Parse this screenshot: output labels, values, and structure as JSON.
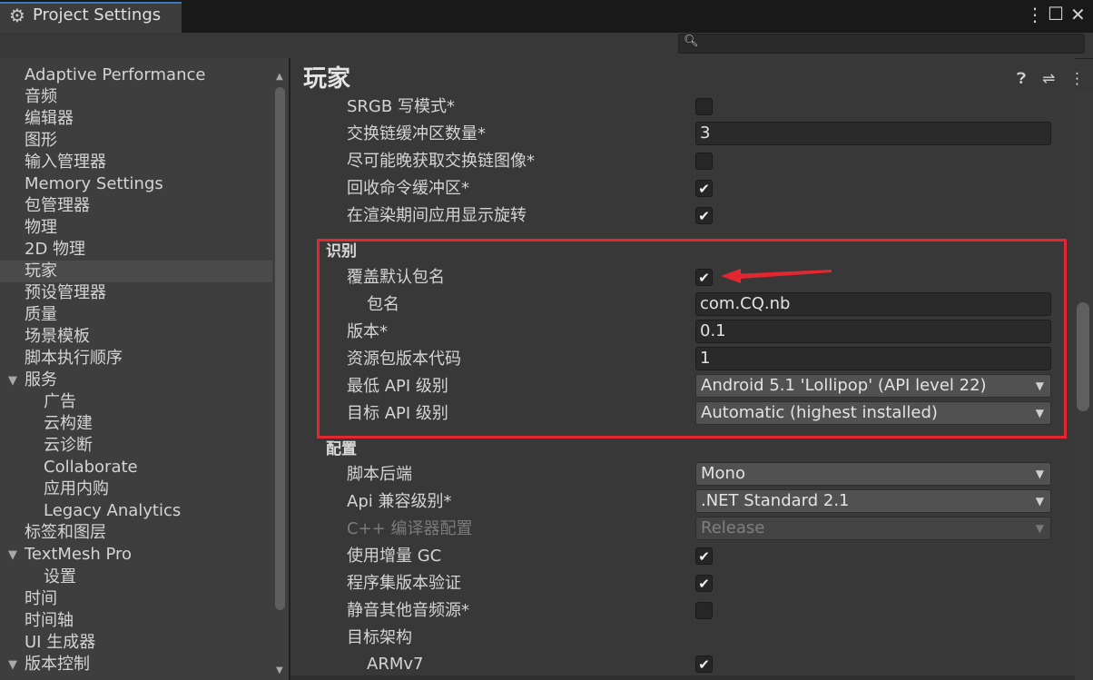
{
  "window": {
    "title": "Project Settings"
  },
  "search": {
    "placeholder": ""
  },
  "sidebar": {
    "items": [
      {
        "label": "Adaptive Performance"
      },
      {
        "label": "音频"
      },
      {
        "label": "编辑器"
      },
      {
        "label": "图形"
      },
      {
        "label": "输入管理器"
      },
      {
        "label": "Memory Settings"
      },
      {
        "label": "包管理器"
      },
      {
        "label": "物理"
      },
      {
        "label": "2D 物理"
      },
      {
        "label": "玩家",
        "selected": true
      },
      {
        "label": "预设管理器"
      },
      {
        "label": "质量"
      },
      {
        "label": "场景模板"
      },
      {
        "label": "脚本执行顺序"
      },
      {
        "label": "服务",
        "expanded": true
      },
      {
        "label": "广告"
      },
      {
        "label": "云构建"
      },
      {
        "label": "云诊断"
      },
      {
        "label": "Collaborate"
      },
      {
        "label": "应用内购"
      },
      {
        "label": "Legacy Analytics"
      },
      {
        "label": "标签和图层"
      },
      {
        "label": "TextMesh Pro",
        "expanded": true
      },
      {
        "label": "设置"
      },
      {
        "label": "时间"
      },
      {
        "label": "时间轴"
      },
      {
        "label": "UI 生成器"
      },
      {
        "label": "版本控制",
        "expanded": true
      }
    ]
  },
  "main": {
    "title": "玩家",
    "rows_top": [
      {
        "label": "SRGB 写模式*",
        "type": "checkbox",
        "checked": false
      },
      {
        "label": "交换链缓冲区数量*",
        "type": "field",
        "value": "3"
      },
      {
        "label": "尽可能晚获取交换链图像*",
        "type": "checkbox",
        "checked": false
      },
      {
        "label": "回收命令缓冲区*",
        "type": "checkbox",
        "checked": true
      },
      {
        "label": "在渲染期间应用显示旋转",
        "type": "checkbox",
        "checked": true
      }
    ],
    "identification": {
      "title": "识别",
      "override_label": "覆盖默认包名",
      "override_checked": true,
      "package_label": "包名",
      "package_value": "com.CQ.nb",
      "version_label": "版本*",
      "version_value": "0.1",
      "bundle_code_label": "资源包版本代码",
      "bundle_code_value": "1",
      "min_api_label": "最低 API 级别",
      "min_api_value": "Android 5.1 'Lollipop' (API level 22)",
      "target_api_label": "目标 API 级别",
      "target_api_value": "Automatic (highest installed)"
    },
    "configuration": {
      "title": "配置",
      "backend_label": "脚本后端",
      "backend_value": "Mono",
      "api_compat_label": "Api 兼容级别*",
      "api_compat_value": ".NET Standard 2.1",
      "cpp_label": "C++ 编译器配置",
      "cpp_value": "Release",
      "incremental_gc_label": "使用增量 GC",
      "incremental_gc_checked": true,
      "assembly_validation_label": "程序集版本验证",
      "assembly_validation_checked": true,
      "mute_label": "静音其他音频源*",
      "mute_checked": false,
      "target_arch_label": "目标架构",
      "armv7_label": "ARMv7",
      "armv7_checked": true
    }
  },
  "colors": {
    "highlight": "#e3262f",
    "tab_accent": "#3a79bb"
  },
  "icons": {
    "settings": "gear-icon",
    "help": "help-icon",
    "presets": "presets-icon",
    "more": "kebab-icon",
    "check": "check-icon"
  }
}
